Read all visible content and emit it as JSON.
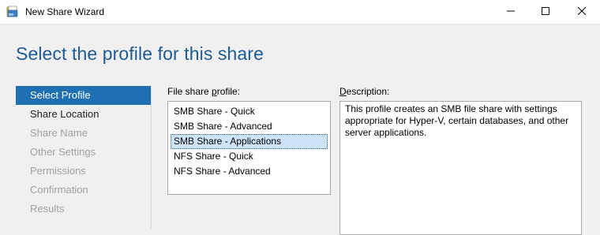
{
  "window": {
    "title": "New Share Wizard",
    "icons": {
      "app": "share-folder-icon",
      "minimize": "minimize-icon",
      "maximize": "maximize-icon",
      "close": "close-icon"
    }
  },
  "page": {
    "title": "Select the profile for this share"
  },
  "nav": {
    "items": [
      {
        "label": "Select Profile",
        "state": "active"
      },
      {
        "label": "Share Location",
        "state": "enabled"
      },
      {
        "label": "Share Name",
        "state": "disabled"
      },
      {
        "label": "Other Settings",
        "state": "disabled"
      },
      {
        "label": "Permissions",
        "state": "disabled"
      },
      {
        "label": "Confirmation",
        "state": "disabled"
      },
      {
        "label": "Results",
        "state": "disabled"
      }
    ]
  },
  "profiles": {
    "label_prefix": "File share ",
    "label_access": "p",
    "label_suffix": "rofile:",
    "items": [
      "SMB Share - Quick",
      "SMB Share - Advanced",
      "SMB Share - Applications",
      "NFS Share - Quick",
      "NFS Share - Advanced"
    ],
    "selected_index": 2
  },
  "description": {
    "label_access": "D",
    "label_rest": "escription:",
    "text": "This profile creates an SMB file share with settings appropriate for Hyper-V, certain databases, and other server applications."
  },
  "colors": {
    "title_blue": "#1e5b94",
    "nav_active_bg": "#1e70b3",
    "selection_bg": "#cde3f7"
  }
}
